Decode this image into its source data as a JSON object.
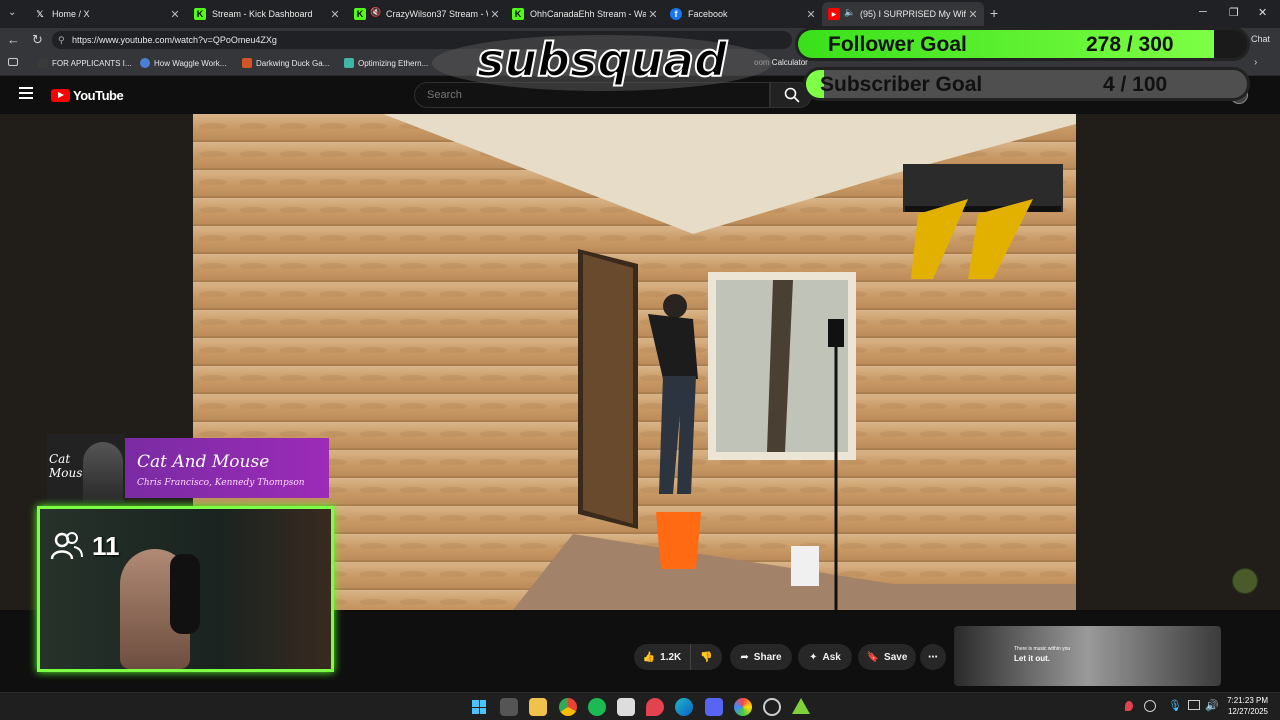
{
  "browser": {
    "tabs": [
      {
        "title": "Home / X",
        "icon": "x-icon"
      },
      {
        "title": "Stream - Kick Dashboard",
        "icon": "kick-icon"
      },
      {
        "title": "CrazyWilson37 Stream - Watc",
        "icon": "kick-icon"
      },
      {
        "title": "OhhCanadaEhh Stream - Wat",
        "icon": "kick-icon"
      },
      {
        "title": "Facebook",
        "icon": "facebook-icon"
      },
      {
        "title": "(95) I SURPRISED My Wife wit",
        "icon": "youtube-icon"
      }
    ],
    "url": "https://www.youtube.com/watch?v=QPoOmeu4ZXg",
    "chat_label": "Chat",
    "bookmarks": [
      {
        "label": "FOR APPLICANTS I...",
        "color": "#3a3a3a"
      },
      {
        "label": "How Waggle Work...",
        "color": "#4a7fd4"
      },
      {
        "label": "Darkwing Duck Ga...",
        "color": "#d4542a"
      },
      {
        "label": "Optimizing Ethern...",
        "color": "#3fb6a8"
      },
      {
        "label": "oom Calculator",
        "color": "#555555"
      }
    ]
  },
  "youtube": {
    "logo_text": "YouTube",
    "search_placeholder": "Search",
    "actions": {
      "likes": "1.2K",
      "share": "Share",
      "ask": "Ask",
      "save": "Save"
    },
    "recommendation": {
      "caption_small": "There is music within you",
      "caption_big": "Let it out."
    }
  },
  "overlay": {
    "brand": "subsquad",
    "follower_goal": {
      "label": "Follower Goal",
      "count": "278 / 300",
      "progress": 0.927
    },
    "subscriber_goal": {
      "label": "Subscriber Goal",
      "count": "4 / 100",
      "progress": 0.04
    },
    "now_playing": {
      "title": "Cat And Mouse",
      "artist": "Chris Francisco, Kennedy Thompson",
      "cover_text": "Cat Mouse"
    },
    "viewers": "11"
  },
  "taskbar": {
    "time": "7:21:23 PM",
    "date": "12/27/2025"
  },
  "colors": {
    "accent_green": "#7dff45",
    "youtube_red": "#ff0000",
    "music_purple": "#9c2bb8"
  }
}
